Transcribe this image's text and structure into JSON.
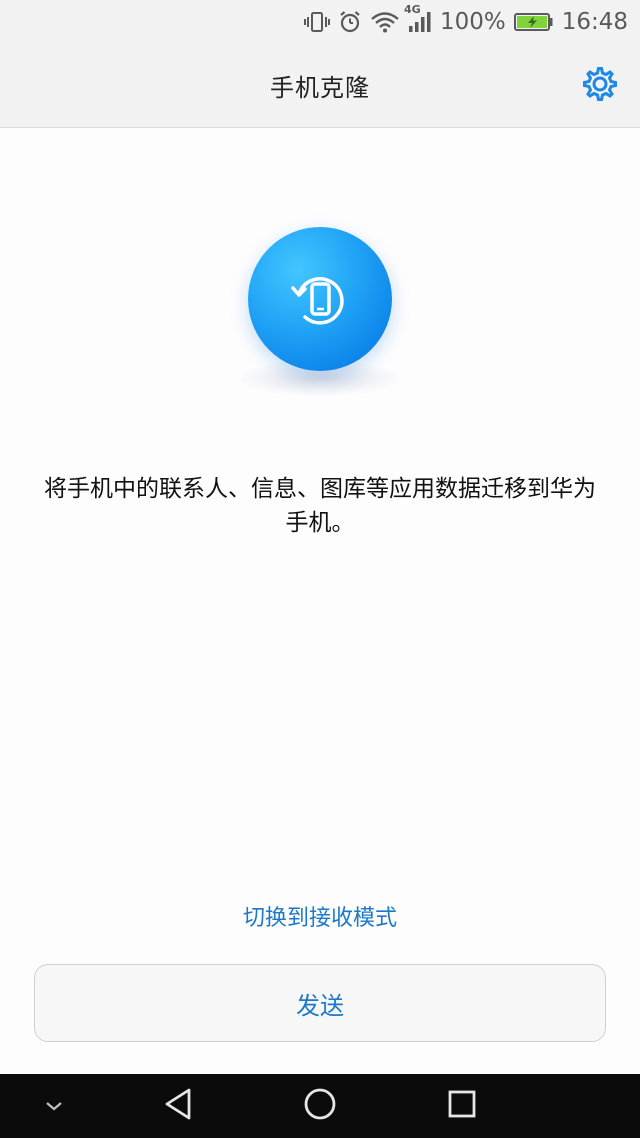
{
  "status_bar": {
    "network": "4G",
    "battery_text": "100%",
    "time": "16:48",
    "battery_color": "#7fd33b"
  },
  "header": {
    "title": "手机克隆",
    "settings_icon": "gear-icon"
  },
  "main": {
    "hero_icon": "phone-clone-icon",
    "description": "将手机中的联系人、信息、图库等应用数据迁移到华为手机。",
    "switch_mode_label": "切换到接收模式",
    "send_label": "发送"
  },
  "nav_bar": {
    "items": [
      "collapse-icon",
      "back-icon",
      "home-icon",
      "recents-icon"
    ]
  },
  "colors": {
    "accent": "#1e78c8",
    "hero": "#1fa2f5"
  }
}
